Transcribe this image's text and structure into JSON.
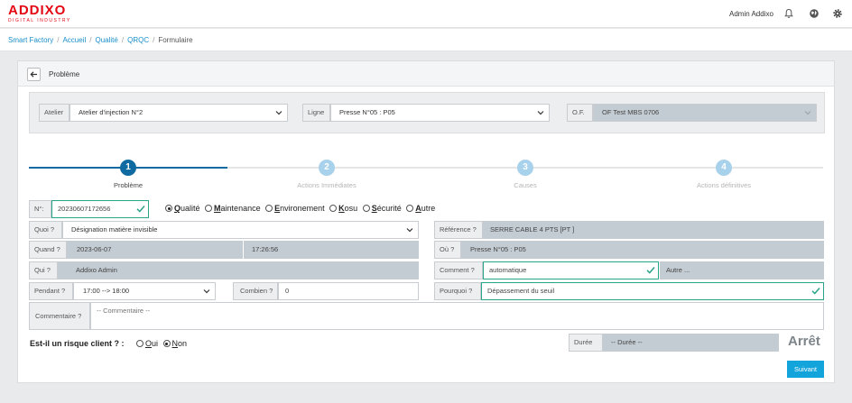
{
  "brand": {
    "name": "ADDIXO",
    "tagline": "DIGITAL INDUSTRY"
  },
  "header": {
    "user": "Admin Addixo"
  },
  "breadcrumb": [
    "Smart Factory",
    "Accueil",
    "Qualité",
    "QRQC",
    "Formulaire"
  ],
  "card": {
    "title": "Problème"
  },
  "selectors": {
    "atelier": {
      "label": "Atelier",
      "value": "Atelier d'injection N°2"
    },
    "ligne": {
      "label": "Ligne",
      "value": "Presse N°05 : P05"
    },
    "of": {
      "label": "O.F.",
      "value": "OF Test MBS 0706"
    }
  },
  "steps": [
    {
      "num": "1",
      "label": "Problème"
    },
    {
      "num": "2",
      "label": "Actions Immédiates"
    },
    {
      "num": "3",
      "label": "Causes"
    },
    {
      "num": "4",
      "label": "Actions définitives"
    }
  ],
  "form": {
    "no_label": "N°:",
    "no_value": "20230607172656",
    "types": [
      {
        "pre": "",
        "key": "Q",
        "rest": "ualité",
        "selected": true
      },
      {
        "pre": "",
        "key": "M",
        "rest": "aintenance",
        "selected": false
      },
      {
        "pre": "",
        "key": "E",
        "rest": "nvironement",
        "selected": false
      },
      {
        "pre": "",
        "key": "K",
        "rest": "osu",
        "selected": false
      },
      {
        "pre": "",
        "key": "S",
        "rest": "écurité",
        "selected": false
      },
      {
        "pre": "",
        "key": "A",
        "rest": "utre",
        "selected": false
      }
    ],
    "quoi_label": "Quoi ?",
    "quoi_value": "Désignation matière invisible",
    "quand_label": "Quand ?",
    "quand_date": "2023-06-07",
    "quand_time": "17:26:56",
    "qui_label": "Qui ?",
    "qui_value": "Addixo Admin",
    "pendant_label": "Pendant ?",
    "pendant_value": "17:00 --> 18:00",
    "combien_label": "Combien ?",
    "combien_value": "0",
    "commentaire_label": "Commentaire ?",
    "commentaire_placeholder": "-- Commentaire --",
    "reference_label": "Référence ?",
    "reference_value": "SERRE CABLE 4 PTS [PT ]",
    "ou_label": "Où ?",
    "ou_value": "Presse N°05 : P05",
    "comment_label": "Comment ?",
    "comment_value": "automatique",
    "comment_other": "Autre ...",
    "pourquoi_label": "Pourquoi ?",
    "pourquoi_value": "Dépassement du seuil",
    "risk_question": "Est-il un risque client ? :",
    "risk_yes_key": "O",
    "risk_yes_rest": "ui",
    "risk_no_key": "N",
    "risk_no_rest": "on",
    "duree_label": "Durée",
    "duree_value": "-- Durée --",
    "arret": "Arrêt",
    "next": "Suivant"
  },
  "colors": {
    "primary": "#0e6aa0",
    "accent": "#14a4dc",
    "valid": "#2aa58a",
    "brand": "#e30613"
  }
}
